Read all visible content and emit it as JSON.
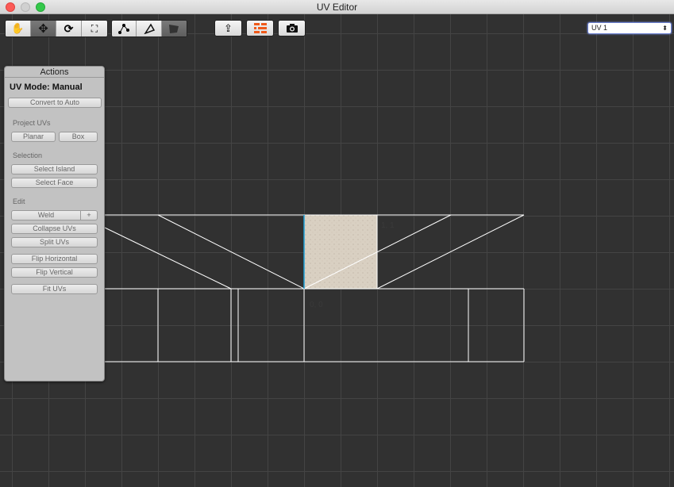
{
  "window": {
    "title": "UV Editor"
  },
  "toolbar": {
    "tools": [
      {
        "name": "hand-tool",
        "icon": "hand-icon"
      },
      {
        "name": "move-tool",
        "icon": "move-icon",
        "active": true
      },
      {
        "name": "rotate-tool",
        "icon": "rotate-icon"
      },
      {
        "name": "scale-tool",
        "icon": "scale-icon"
      }
    ],
    "modes": [
      {
        "name": "vertex-mode",
        "icon": "vertex-icon"
      },
      {
        "name": "edge-mode",
        "icon": "edge-icon"
      },
      {
        "name": "face-mode",
        "icon": "face-icon",
        "active": true
      }
    ],
    "export_icon": "export-icon",
    "texture_icon": "brick-texture-icon",
    "screenshot_icon": "camera-icon",
    "uv_channel": "UV 1"
  },
  "actions": {
    "title": "Actions",
    "mode": "UV Mode: Manual",
    "convert": "Convert to Auto",
    "project_label": "Project UVs",
    "planar": "Planar",
    "box": "Box",
    "selection_label": "Selection",
    "select_island": "Select Island",
    "select_face": "Select Face",
    "edit_label": "Edit",
    "weld": "Weld",
    "weld_plus": "+",
    "collapse": "Collapse UVs",
    "split": "Split UVs",
    "flip_h": "Flip Horizontal",
    "flip_v": "Flip Vertical",
    "fit": "Fit UVs"
  },
  "canvas": {
    "origin_label": "0, 0",
    "one_label": "1, 1",
    "selected_edge_color": "#1e9fd6",
    "wire_color": "#ffffff"
  }
}
